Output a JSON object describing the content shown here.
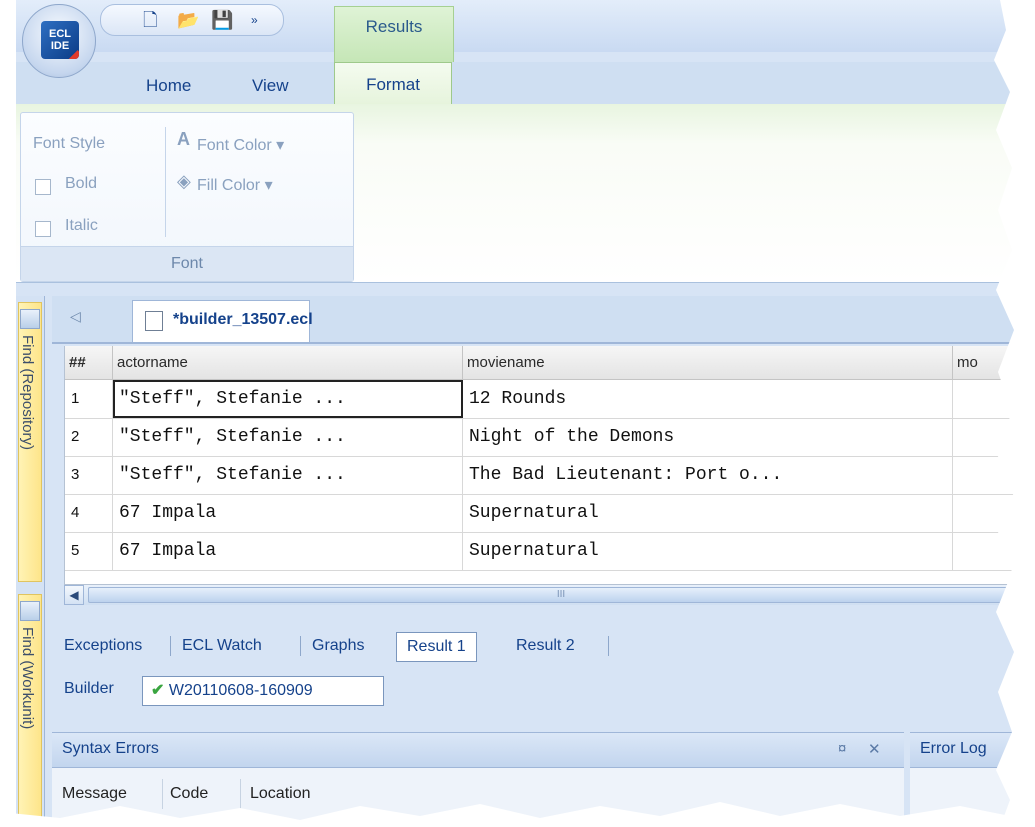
{
  "app": {
    "logo_text": "ECL IDE",
    "quick_access": {
      "new_icon": "new-file-icon",
      "open_icon": "open-folder-icon",
      "save_icon": "save-icon",
      "more_icon": "more-icon"
    }
  },
  "ribbon": {
    "context_tab_label": "Results",
    "tabs": [
      "Home",
      "View",
      "Format"
    ],
    "active_tab": "Format",
    "font_style_label": "Font Style",
    "bold_label": "Bold",
    "italic_label": "Italic",
    "font_color_label": "Font Color",
    "fill_color_label": "Fill Color",
    "group_label": "Font"
  },
  "side_panels": [
    "Find (Repository)",
    "Find (Workunit)"
  ],
  "document": {
    "tab_title": "*builder_13507.ecl"
  },
  "grid": {
    "headers": [
      "##",
      "actorname",
      "moviename",
      "mo"
    ],
    "rows": [
      {
        "num": "1",
        "actor": "\"Steff\", Stefanie ...",
        "movie": "12 Rounds"
      },
      {
        "num": "2",
        "actor": "\"Steff\", Stefanie ...",
        "movie": "Night of the Demons"
      },
      {
        "num": "3",
        "actor": "\"Steff\", Stefanie ...",
        "movie": "The Bad Lieutenant: Port o..."
      },
      {
        "num": "4",
        "actor": "67 Impala",
        "movie": "Supernatural"
      },
      {
        "num": "5",
        "actor": "67 Impala",
        "movie": "Supernatural"
      }
    ],
    "scroll_grip": "III"
  },
  "result_tabs": [
    "Exceptions",
    "ECL Watch",
    "Graphs",
    "Result 1",
    "Result 2"
  ],
  "active_result_tab": "Result 1",
  "builder": {
    "label": "Builder",
    "workunit": "W20110608-160909"
  },
  "panels": {
    "syntax_title": "Syntax Errors",
    "pin": "¤",
    "close": "✕",
    "columns": [
      "Message",
      "Code",
      "Location"
    ],
    "error_title": "Error Log"
  }
}
